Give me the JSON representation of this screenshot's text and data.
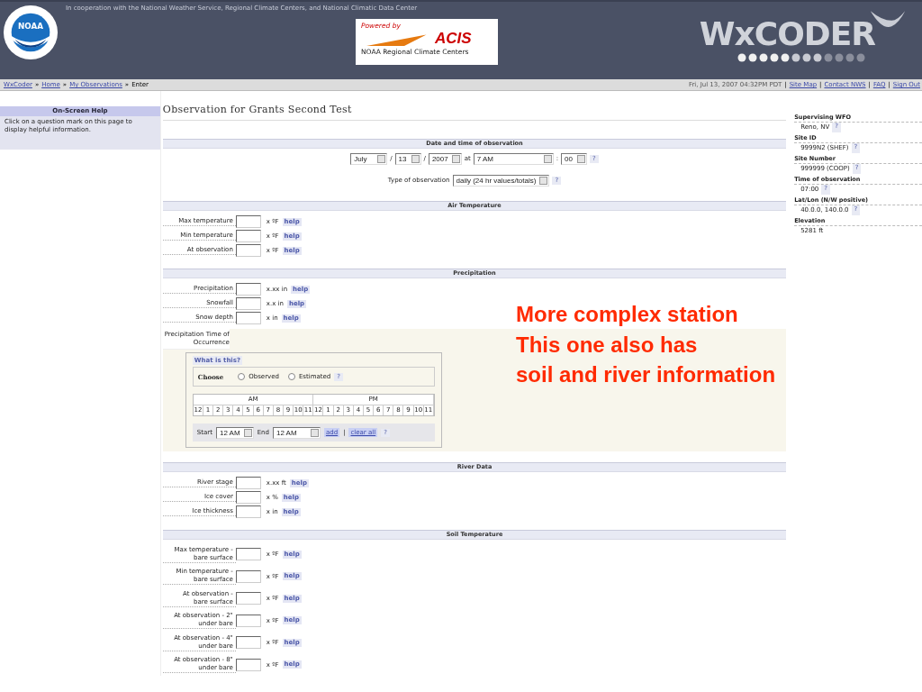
{
  "header": {
    "cooperation": "In cooperation with the National Weather Service, Regional Climate Centers, and National Climatic Data Center",
    "noaa_logo": "NOAA",
    "acis": {
      "powered_by": "Powered by",
      "name": "ACIS",
      "subtitle": "NOAA Regional Climate Centers"
    },
    "wxcoder": "WxCODER"
  },
  "breadcrumb": {
    "separator": "»",
    "items": [
      {
        "label": "WxCoder",
        "link": true
      },
      {
        "label": "Home",
        "link": true
      },
      {
        "label": "My Observations",
        "link": true
      },
      {
        "label": "Enter",
        "link": false
      }
    ],
    "timestamp": "Fri, Jul 13, 2007 04:32PM PDT",
    "divider": "|",
    "links": [
      "Site Map",
      "Contact NWS",
      "FAQ",
      "Sign Out"
    ]
  },
  "sidebar": {
    "title": "On-Screen Help",
    "text": "Click on a question mark on this page to display helpful information."
  },
  "main": {
    "title": "Observation for Grants Second Test",
    "sections": [
      {
        "kind": "datetime",
        "title": "Date and time of observation",
        "month": "July",
        "day": "13",
        "year": "2007",
        "slash": "/",
        "at": "at",
        "hour": "7 AM",
        "colon": ":",
        "minute": "00",
        "help": "?",
        "type_label": "Type of observation",
        "type_value": "daily (24 hr values/totals)"
      },
      {
        "kind": "fields",
        "title": "Air Temperature",
        "fields": [
          {
            "label": "Max temperature",
            "unit": "x ºF",
            "help": "help"
          },
          {
            "label": "Min temperature",
            "unit": "x ºF",
            "help": "help"
          },
          {
            "label": "At observation",
            "unit": "x ºF",
            "help": "help"
          }
        ]
      },
      {
        "kind": "fields",
        "title": "Precipitation",
        "fields": [
          {
            "label": "Precipitation",
            "unit": "x.xx in",
            "help": "help"
          },
          {
            "label": "Snowfall",
            "unit": "x.x in",
            "help": "help"
          },
          {
            "label": "Snow depth",
            "unit": "x in",
            "help": "help"
          }
        ],
        "occurrence": {
          "label": "Precipitation Time of Occurrence",
          "what": "What is this?",
          "choose": "Choose",
          "options": [
            {
              "label": "Observed",
              "selected": false
            },
            {
              "label": "Estimated",
              "selected": false
            }
          ],
          "help": "?",
          "am": "AM",
          "pm": "PM",
          "hours": [
            "12",
            "1",
            "2",
            "3",
            "4",
            "5",
            "6",
            "7",
            "8",
            "9",
            "10",
            "11",
            "12",
            "1",
            "2",
            "3",
            "4",
            "5",
            "6",
            "7",
            "8",
            "9",
            "10",
            "11"
          ],
          "start_label": "Start",
          "start": "12 AM",
          "end_label": "End",
          "end": "12 AM",
          "add": "add",
          "divider": "|",
          "clear": "clear all",
          "help2": "?"
        }
      },
      {
        "kind": "fields",
        "title": "River Data",
        "fields": [
          {
            "label": "River stage",
            "unit": "x.xx ft",
            "help": "help"
          },
          {
            "label": "Ice cover",
            "unit": "x %",
            "help": "help"
          },
          {
            "label": "Ice thickness",
            "unit": "x in",
            "help": "help"
          }
        ]
      },
      {
        "kind": "twoline",
        "title": "Soil Temperature",
        "fields": [
          {
            "label": "Max temperature - bare surface",
            "unit": "x ºF",
            "help": "help"
          },
          {
            "label": "Min temperature - bare surface",
            "unit": "x ºF",
            "help": "help"
          },
          {
            "label": "At observation - bare surface",
            "unit": "x ºF",
            "help": "help"
          },
          {
            "label": "At observation - 2\" under bare",
            "unit": "x ºF",
            "help": "help"
          },
          {
            "label": "At observation - 4\" under bare",
            "unit": "x ºF",
            "help": "help"
          },
          {
            "label": "At observation - 8\" under bare",
            "unit": "x ºF",
            "help": "help"
          }
        ]
      }
    ]
  },
  "station": [
    {
      "label": "Supervising WFO",
      "value": "Reno, NV",
      "help": "?"
    },
    {
      "label": "Site ID",
      "value": "9999N2 (SHEF)",
      "help": "?"
    },
    {
      "label": "Site Number",
      "value": "999999 (COOP)",
      "help": "?"
    },
    {
      "label": "Time of observation",
      "value": "07:00",
      "help": "?"
    },
    {
      "label": "Lat/Lon (N/W positive)",
      "value": "40.0.0, 140.0.0",
      "help": "?"
    },
    {
      "label": "Elevation",
      "value": "5281 ft"
    }
  ],
  "annotation": [
    "More complex station",
    "This one also has",
    "soil and river information"
  ]
}
